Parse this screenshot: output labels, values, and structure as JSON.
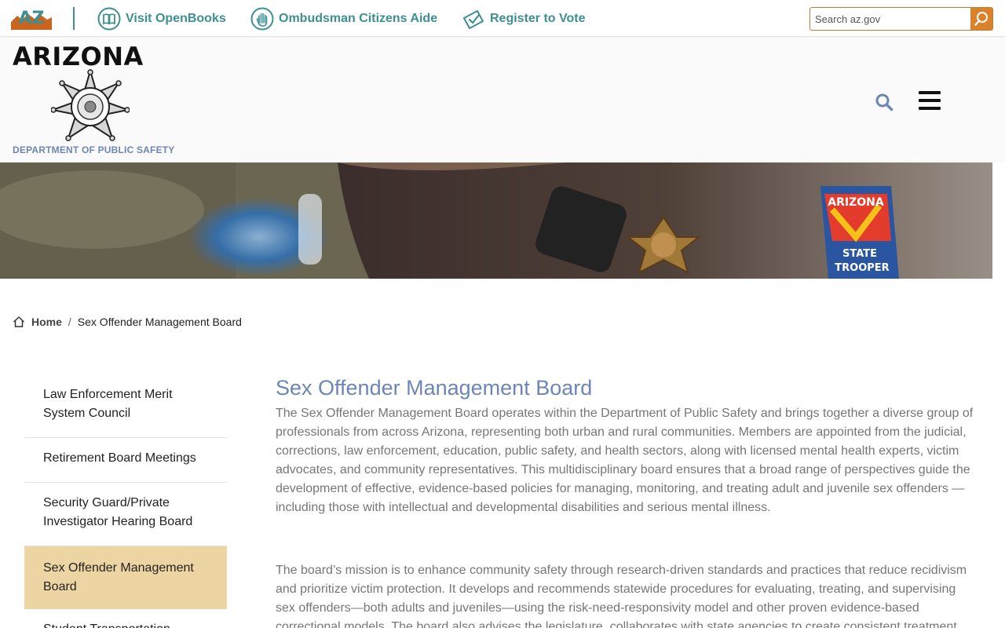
{
  "topbar": {
    "logo_text": "AZ",
    "links": [
      {
        "label": "Visit OpenBooks",
        "icon": "book-icon"
      },
      {
        "label": "Ombudsman Citizens Aide",
        "icon": "hand-icon"
      },
      {
        "label": "Register to Vote",
        "icon": "ballot-icon"
      }
    ],
    "search_placeholder": "Search az.gov"
  },
  "header": {
    "wordmark": "ARIZONA",
    "department": "DEPARTMENT OF PUBLIC SAFETY"
  },
  "breadcrumb": {
    "home": "Home",
    "separator": "/",
    "current": "Sex Offender Management Board"
  },
  "sidebar": {
    "items": [
      {
        "label": "Law Enforcement Merit System Council"
      },
      {
        "label": "Retirement Board Meetings"
      },
      {
        "label": "Security Guard/Private Investigator Hearing Board"
      },
      {
        "label": "Sex Offender Management Board"
      },
      {
        "label": "Student Transportation"
      }
    ]
  },
  "main": {
    "title": "Sex Offender Management Board",
    "paragraphs": [
      "The Sex Offender Management Board operates within the Department of Public Safety and brings together a diverse group of professionals from across Arizona, representing both urban and rural communities. Members are appointed from the judicial, corrections, law enforcement, education, public safety, and health sectors, along with licensed mental health experts, victim advocates, and community representatives. This multidisciplinary board ensures that a broad range of perspectives guide the development of effective, evidence-based policies for managing, monitoring, and treating adult and juvenile sex offenders — including those with intellectual and developmental disabilities and serious mental illness.",
      "The board’s mission is to enhance community safety through research-driven standards and practices that reduce recidivism and prioritize victim protection. It develops and recommends statewide procedures for evaluating, treating, and supervising sex offenders—both adults and juveniles—using the risk-need-responsivity model and other proven evidence-based correctional models. The board also advises the legislature, collaborates with state agencies to create consistent treatment"
    ]
  },
  "colors": {
    "teal": "#3d8f92",
    "accent_orange": "#d9822b",
    "title_blue": "#6c86b8",
    "active_tan": "#ecd5a2"
  }
}
